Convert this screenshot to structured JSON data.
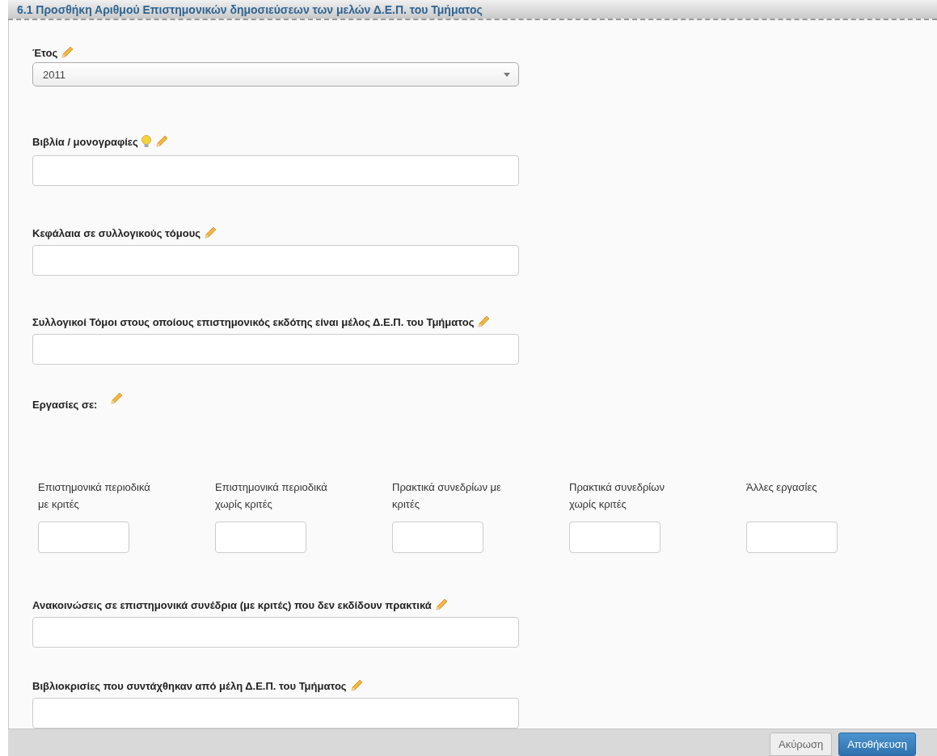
{
  "header": {
    "title": "6.1 Προσθήκη Αριθμού Επιστημονικών δημοσιεύσεων των μελών Δ.Ε.Π. του Τμήματος"
  },
  "fields": [
    {
      "kind": "select",
      "label": "Έτος",
      "value": "2011"
    },
    {
      "kind": "text",
      "label": "Βιβλία / μονογραφίες",
      "hint": true
    },
    {
      "kind": "text",
      "label": "Κεφάλαια σε συλλογικούς τόμους"
    },
    {
      "kind": "text",
      "label": "Συλλογικοί Τόμοι στους οποίους επιστημονικός εκδότης είναι μέλος Δ.Ε.Π. του Τμήματος"
    },
    {
      "kind": "group",
      "label": "Εργασίες σε:",
      "subfields": [
        "Επιστημονικά περιοδικά με κριτές",
        "Επιστημονικά περιοδικά χωρίς κριτές",
        "Πρακτικά συνεδρίων με κριτές",
        "Πρακτικά συνεδρίων χωρίς κριτές",
        "Άλλες εργασίες"
      ]
    },
    {
      "kind": "text",
      "label": "Ανακοινώσεις σε επιστημονικά συνέδρια (με κριτές) που δεν εκδίδουν πρακτικά"
    },
    {
      "kind": "text",
      "label": "Βιβλιοκρισίες που συντάχθηκαν από μέλη Δ.Ε.Π. του Τμήματος"
    }
  ],
  "buttons": [
    {
      "kind": "cancel",
      "label": "Ακύρωση"
    },
    {
      "kind": "primary",
      "label": "Αποθήκευση"
    }
  ]
}
